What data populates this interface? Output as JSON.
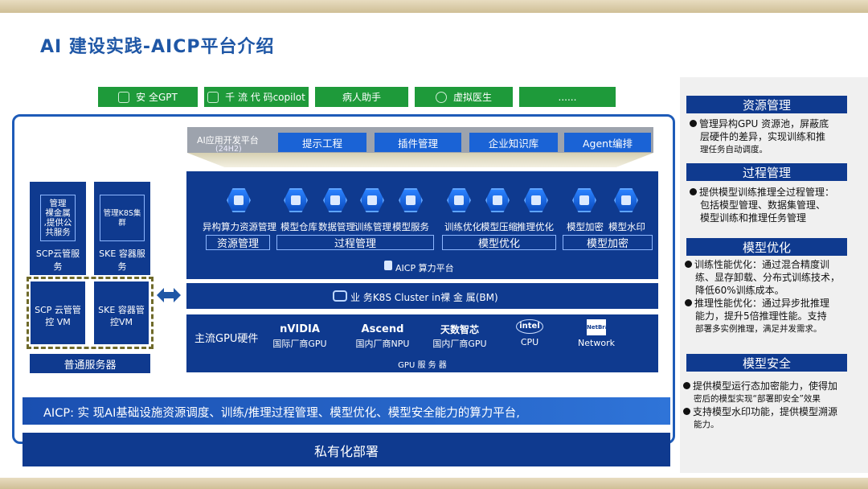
{
  "title": "AI 建设实践-AICP平台介绍",
  "top_apps": [
    {
      "label": "安 全GPT",
      "icon": "gpt-icon"
    },
    {
      "label": "千 流 代 码copilot",
      "icon": "code-icon"
    },
    {
      "label": "病人助手",
      "icon": ""
    },
    {
      "label": "虚拟医生",
      "icon": "doctor-icon"
    },
    {
      "label": "......",
      "icon": ""
    }
  ],
  "dev_platform": {
    "label": "AI应用开发平台",
    "sub": "(24H2)",
    "items": [
      "提示工程",
      "插件管理",
      "企业知识库",
      "Agent编排"
    ]
  },
  "aicp": {
    "modules": [
      {
        "label": "异构算力资源管理",
        "icon": "gpu-resource-icon"
      },
      {
        "label": "模型仓库",
        "icon": "model-repo-icon"
      },
      {
        "label": "数据管理",
        "icon": "data-mgmt-icon"
      },
      {
        "label": "训练管理",
        "icon": "train-mgmt-icon"
      },
      {
        "label": "模型服务",
        "icon": "model-service-icon"
      },
      {
        "label": "训练优化",
        "icon": "train-opt-icon"
      },
      {
        "label": "模型压缩",
        "icon": "model-compress-icon"
      },
      {
        "label": "推理优化",
        "icon": "infer-opt-icon"
      },
      {
        "label": "模型加密",
        "icon": "model-encrypt-icon"
      },
      {
        "label": "模型水印",
        "icon": "model-watermark-icon"
      }
    ],
    "groups": [
      "资源管理",
      "过程管理",
      "模型优化",
      "模型加密"
    ],
    "platform_label": "AICP 算力平台"
  },
  "k8s_label": "业 务K8S Cluster in裸 金 属(BM)",
  "gpu": {
    "label": "主流GPU硬件",
    "vendors": [
      {
        "logo": "nVIDIA",
        "label": "国际厂商GPU"
      },
      {
        "logo": "Ascend",
        "label": "国内厂商NPU"
      },
      {
        "logo": "天数智芯",
        "label": "国内厂商GPU"
      },
      {
        "logo": "intel",
        "label": "CPU"
      },
      {
        "logo": "NetBrain",
        "label": "Network"
      }
    ],
    "server_label": "GPU 服 务 器"
  },
  "left": {
    "mgmt1": "管理\n裸金属\n,提供公\n共服务",
    "mgmt2": "管理K8S集\n群",
    "scp_service": "SCP云管服\n务",
    "ske_service": "SKE 容器服\n务",
    "scp_vm": "SCP 云管管\n控 VM",
    "ske_vm": "SKE 容器管\n控VM",
    "server": "普通服务器"
  },
  "summary": "AICP: 实 现AI基础设施资源调度、训练/推理过程管理、模型优化、模型安全能力的算力平台,",
  "deploy": "私有化部署",
  "right": [
    {
      "head": "资源管理",
      "lines": [
        "管理异构GPU 资源池，屏蔽底",
        "层硬件的差异，实现训练和推",
        "理任务自动调度。"
      ]
    },
    {
      "head": "过程管理",
      "lines": [
        "提供模型训练推理全过程管理：",
        "包括模型管理、数据集管理、",
        "模型训练和推理任务管理"
      ]
    },
    {
      "head": "模型优化",
      "lines": [
        "训练性能优化：通过混合精度训",
        "练、显存卸载、分布式训练技术，",
        "降低60%训练成本。",
        "推理性能优化：通过异步批推理",
        "能力，提升5倍推理性能。支持",
        "部署多实例推理，满足并发需求。"
      ]
    },
    {
      "head": "模型安全",
      "lines": [
        "提供模型运行态加密能力，使得加",
        "密后的模型实现“部署即安全”效果",
        "支持模型水印功能，提供模型溯源",
        "能力。"
      ]
    }
  ]
}
